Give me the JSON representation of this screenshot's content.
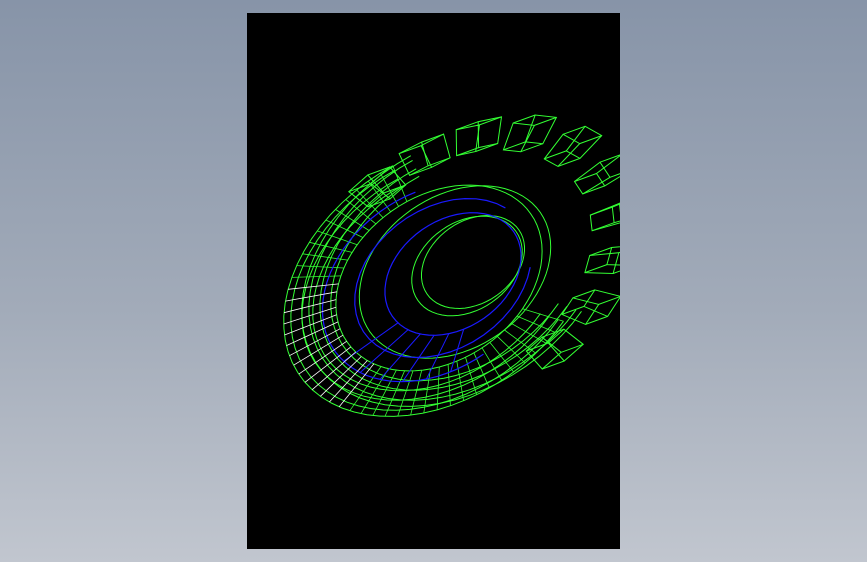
{
  "background": {
    "gradient_top": "#8794a8",
    "gradient_bottom": "#c1c6cf"
  },
  "viewport": {
    "background": "#000000"
  },
  "model": {
    "render_mode": "wireframe",
    "outer_wire_color": "#33ff33",
    "inner_wire_color": "#1a1aff",
    "highlight_wire_color": "#ffffff",
    "tooth_count": 10
  }
}
